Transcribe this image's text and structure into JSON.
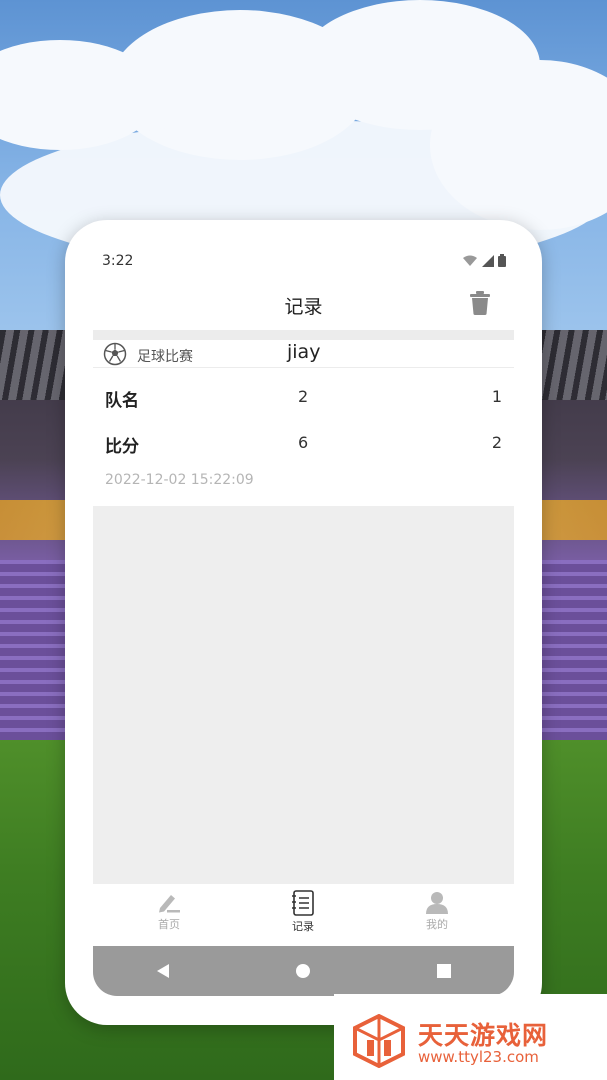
{
  "status_bar": {
    "time": "3:22"
  },
  "header": {
    "title": "记录"
  },
  "record": {
    "match_type": "足球比赛",
    "player": "jiay",
    "rows": [
      {
        "label": "队名",
        "value1": "2",
        "value2": "1"
      },
      {
        "label": "比分",
        "value1": "6",
        "value2": "2"
      }
    ],
    "timestamp": "2022-12-02 15:22:09"
  },
  "bottom_nav": {
    "items": [
      {
        "label": "首页",
        "icon": "pencil-icon",
        "active": false
      },
      {
        "label": "记录",
        "icon": "notebook-icon",
        "active": true
      },
      {
        "label": "我的",
        "icon": "user-icon",
        "active": false
      }
    ]
  },
  "system_nav": {
    "back": "back-triangle-icon",
    "home": "home-circle-icon",
    "recents": "recents-square-icon"
  },
  "watermark": {
    "title": "天天游戏网",
    "url": "www.ttyl23.com"
  },
  "colors": {
    "accent": "#e8613a",
    "nav_active": "#333333",
    "nav_inactive": "#aaaaaa",
    "empty_bg": "#eeeeee"
  }
}
